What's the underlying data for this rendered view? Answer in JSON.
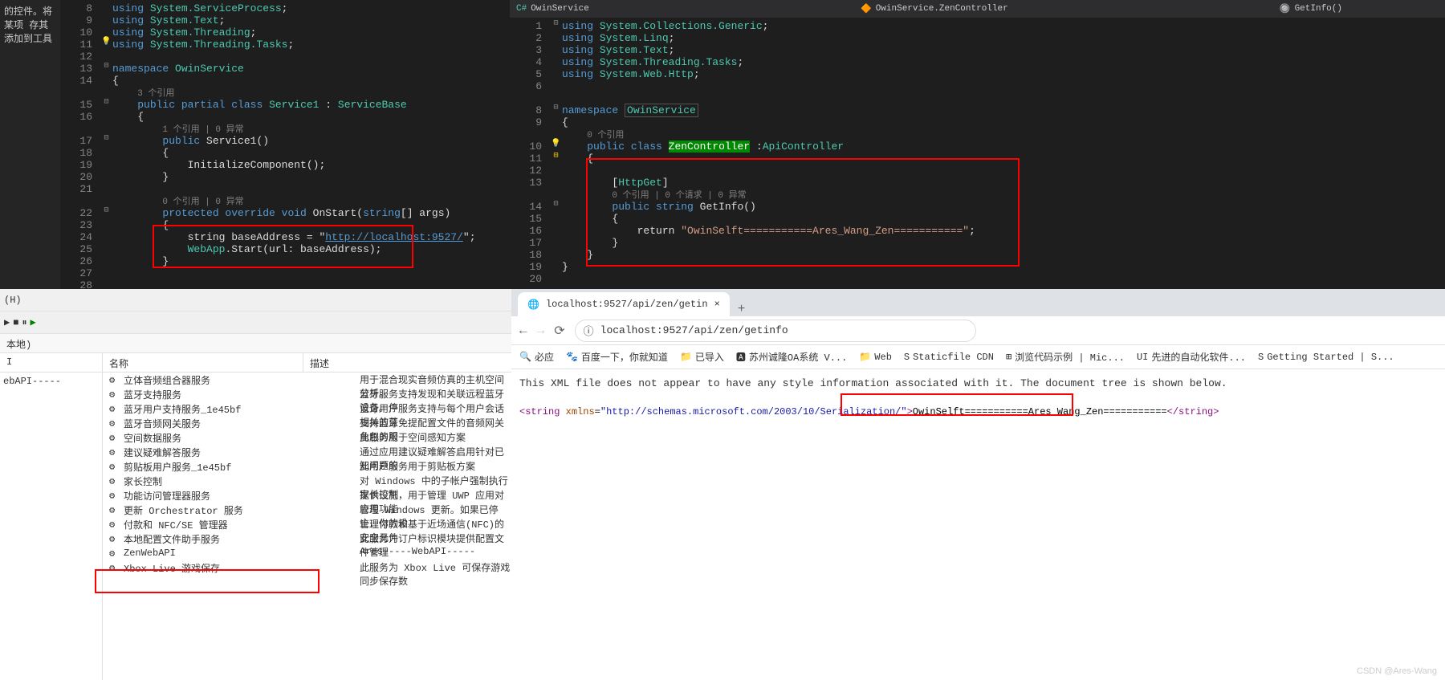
{
  "left_margin_text": "的控件。将某项\n存其添加到工具",
  "left_editor": {
    "lines": {
      "8": {
        "text": "using System.ServiceProcess;",
        "kw": [
          "using"
        ],
        "types": [
          "System",
          "ServiceProcess"
        ]
      },
      "9": {
        "text": "using System.Text;",
        "kw": [
          "using"
        ],
        "types": [
          "System",
          "Text"
        ]
      },
      "10": {
        "text": "using System.Threading;",
        "kw": [
          "using"
        ],
        "types": [
          "System",
          "Threading"
        ]
      },
      "11": {
        "text": "using System.Threading.Tasks;",
        "kw": [
          "using"
        ],
        "types": [
          "System",
          "Threading",
          "Tasks"
        ]
      },
      "13": "namespace OwinService",
      "14": "{",
      "ref15": "3 个引用",
      "15": "    public partial class Service1 : ServiceBase",
      "16": "    {",
      "ref17": "1 个引用 | 0 异常",
      "17": "        public Service1()",
      "18": "        {",
      "19": "            InitializeComponent();",
      "20": "        }",
      "ref22": "0 个引用 | 0 异常",
      "22": "        protected override void OnStart(string[] args)",
      "23": "        {",
      "24_pre": "            string baseAddress = \"",
      "24_url": "http://localhost:9527/",
      "24_post": "\";",
      "25": "            WebApp.Start(url: baseAddress);",
      "26": "        }"
    }
  },
  "right_editor": {
    "crumbs": [
      "OwinService",
      "OwinService.ZenController",
      "GetInfo()"
    ],
    "lines": {
      "1": "using System.Collections.Generic;",
      "2": "using System.Linq;",
      "3": "using System.Text;",
      "4": "using System.Threading.Tasks;",
      "5": "using System.Web.Http;",
      "8": "namespace OwinService",
      "9": "{",
      "ref10": "0 个引用",
      "10": "    public class ZenController :ApiController",
      "11": "    {",
      "13_attr": "        [HttpGet]",
      "ref14": "0 个引用 | 0 个请求 | 0 异常",
      "14": "        public string GetInfo()",
      "15": "        {",
      "16_pre": "            return ",
      "16_str": "\"OwinSelft===========Ares_Wang_Zen===========\"",
      "16_post": ";",
      "17": "        }",
      "18": "    }",
      "19": "}"
    }
  },
  "services": {
    "menu_h": "(H)",
    "filter": "本地)",
    "col_left": "I",
    "col_name": "名称",
    "col_desc": "描述",
    "left_text": "ebAPI-----",
    "rows": [
      {
        "name": "立体音频组合器服务",
        "desc": "用于混合现实音频仿真的主机空间分析。"
      },
      {
        "name": "蓝牙支持服务",
        "desc": "蓝牙服务支持发现和关联远程蓝牙设备。停"
      },
      {
        "name": "蓝牙用户支持服务_1e45bf",
        "desc": "蓝牙用户服务支持与每个用户会话相关的蓝"
      },
      {
        "name": "蓝牙音频网关服务",
        "desc": "支持蓝牙免提配置文件的音频网关角色的服"
      },
      {
        "name": "空间数据服务",
        "desc": "此服务用于空间感知方案"
      },
      {
        "name": "建议疑难解答服务",
        "desc": "通过应用建议疑难解答启用针对已知问题的"
      },
      {
        "name": "剪贴板用户服务_1e45bf",
        "desc": "此用户服务用于剪贴板方案"
      },
      {
        "name": "家长控制",
        "desc": "对 Windows 中的子帐户强制执行家长控制"
      },
      {
        "name": "功能访问管理器服务",
        "desc": "提供设施，用于管理 UWP 应用对应用功能"
      },
      {
        "name": "更新 Orchestrator 服务",
        "desc": "管理 Windows 更新。如果已停止，你的设"
      },
      {
        "name": "付款和 NFC/SE 管理器",
        "desc": "管理付款和基于近场通信(NFC)的安全元件"
      },
      {
        "name": "本地配置文件助手服务",
        "desc": "此服务为订户标识模块提供配置文件管理"
      },
      {
        "name": "ZenWebAPI",
        "desc": "Ares-----WebAPI-----"
      },
      {
        "name": "Xbox Live 游戏保存",
        "desc": "此服务为 Xbox Live 可保存游戏同步保存数"
      }
    ]
  },
  "browser": {
    "tab_title": "localhost:9527/api/zen/getin",
    "url": "localhost:9527/api/zen/getinfo",
    "bookmarks": [
      {
        "icon": "🔍",
        "label": "必应"
      },
      {
        "icon": "🐾",
        "label": "百度一下，你就知道"
      },
      {
        "icon": "📁",
        "label": "已导入"
      },
      {
        "icon": "🅰",
        "label": "苏州诚隆OA系统 V..."
      },
      {
        "icon": "📁",
        "label": "Web"
      },
      {
        "icon": "S",
        "label": "Staticfile CDN"
      },
      {
        "icon": "⊞",
        "label": "浏览代码示例 | Mic..."
      },
      {
        "icon": "UI",
        "label": "先进的自动化软件..."
      },
      {
        "icon": "S",
        "label": "Getting Started | S..."
      }
    ],
    "msg": "This XML file does not appear to have any style information associated with it. The document tree is shown below.",
    "xml": {
      "open": "<string",
      "attr_name": "xmlns",
      "attr_val": "\"http://schemas.microsoft.com/2003/10/Serialization/\"",
      "text": "OwinSelft===========Ares_Wang_Zen===========",
      "close": "</string>"
    }
  },
  "watermark": "CSDN @Ares-Wang"
}
